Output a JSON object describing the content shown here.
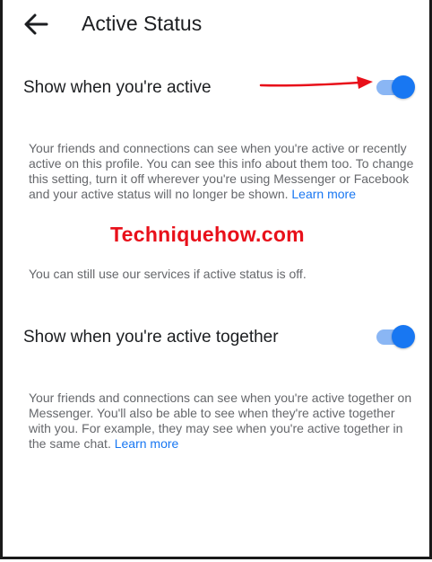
{
  "header": {
    "title": "Active Status",
    "back_icon": "arrow-left-icon"
  },
  "settings": [
    {
      "label": "Show when you're active",
      "enabled": true,
      "description": "Your friends and connections can see when you're active or recently active on this profile. You can see this info about them too. To change this setting, turn it off wherever you're using Messenger or Facebook and your active status will no longer be shown.",
      "learn_more": "Learn more",
      "note": "You can still use our services if active status is off."
    },
    {
      "label": "Show when you're active together",
      "enabled": true,
      "description": "Your friends and connections can see when you're active together on Messenger. You'll also be able to see when they're active together with you. For example, they may see when you're active together in the same chat.",
      "learn_more": "Learn more"
    }
  ],
  "watermark": "Techniquehow.com",
  "annotation": {
    "arrow_icon": "red-arrow-icon",
    "arrow_color": "#e8101a"
  },
  "colors": {
    "accent": "#1877f2",
    "toggle_track": "#8ab6f4",
    "text_primary": "#1c1e21",
    "text_secondary": "#65676b"
  }
}
